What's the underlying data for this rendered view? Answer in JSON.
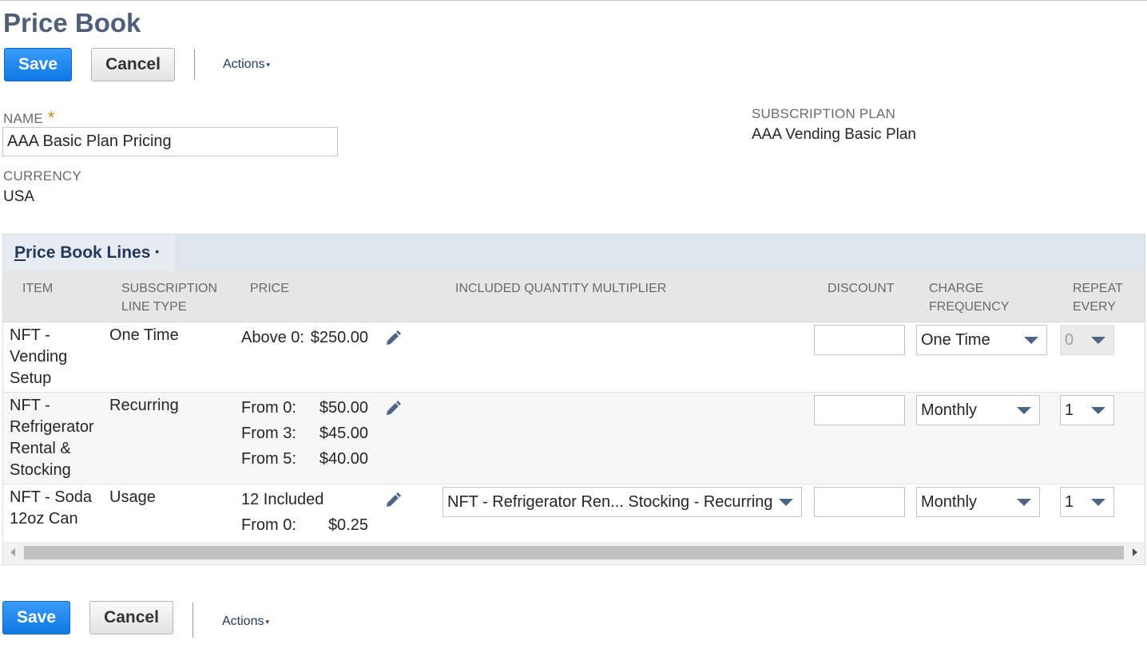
{
  "page": {
    "title": "Price Book"
  },
  "toolbar": {
    "save_label": "Save",
    "cancel_label": "Cancel",
    "actions_label": "Actions",
    "caret": "▾"
  },
  "fields": {
    "name": {
      "label": "NAME",
      "required_marker": "*",
      "value": "AAA Basic Plan Pricing"
    },
    "currency": {
      "label": "CURRENCY",
      "value": "USA"
    },
    "subscription_plan": {
      "label": "SUBSCRIPTION PLAN",
      "value": "AAA Vending Basic Plan"
    }
  },
  "sublist": {
    "tab_label_first": "P",
    "tab_label_rest": "rice Book Lines",
    "tab_dot": "•",
    "columns": {
      "item": "ITEM",
      "subscription_line_type_1": "SUBSCRIPTION",
      "subscription_line_type_2": "LINE TYPE",
      "price": "PRICE",
      "included_quantity_multiplier": "INCLUDED QUANTITY MULTIPLIER",
      "discount": "DISCOUNT",
      "charge_frequency_1": "CHARGE",
      "charge_frequency_2": "FREQUENCY",
      "repeat_every_1": "REPEAT",
      "repeat_every_2": "EVERY"
    },
    "rows": [
      {
        "item_lines": [
          "NFT -",
          "Vending",
          "Setup"
        ],
        "line_type": "One Time",
        "price_lines": [
          {
            "label": "Above 0:",
            "amount": "$250.00"
          }
        ],
        "multiplier": "",
        "discount": "",
        "charge_frequency": "One Time",
        "repeat_every": "0",
        "repeat_disabled": true
      },
      {
        "item_lines": [
          "NFT -",
          "Refrigerator",
          "Rental &",
          "Stocking"
        ],
        "line_type": "Recurring",
        "price_lines": [
          {
            "label": "From 0:",
            "amount": "$50.00"
          },
          {
            "label": "From 3:",
            "amount": "$45.00"
          },
          {
            "label": "From 5:",
            "amount": "$40.00"
          }
        ],
        "multiplier": "",
        "discount": "",
        "charge_frequency": "Monthly",
        "repeat_every": "1",
        "repeat_disabled": false
      },
      {
        "item_lines": [
          "NFT - Soda",
          "12oz Can"
        ],
        "line_type": "Usage",
        "price_lines": [
          {
            "label": "12 Included",
            "amount": ""
          },
          {
            "label": "From 0:",
            "amount": "$0.25"
          }
        ],
        "multiplier": "NFT - Refrigerator Ren... Stocking - Recurring",
        "discount": "",
        "charge_frequency": "Monthly",
        "repeat_every": "1",
        "repeat_disabled": false
      }
    ]
  },
  "colors": {
    "primary": "#1a7ee8",
    "title": "#4d5f79",
    "link": "#24385b",
    "required": "#c98a1a",
    "tab_bg": "#dde5ef",
    "header_bg": "#e6e6e6"
  },
  "icons": {
    "edit": "pencil-icon",
    "dropdown": "chevron-down-icon",
    "scroll_left": "arrow-left-icon",
    "scroll_right": "arrow-right-icon"
  }
}
